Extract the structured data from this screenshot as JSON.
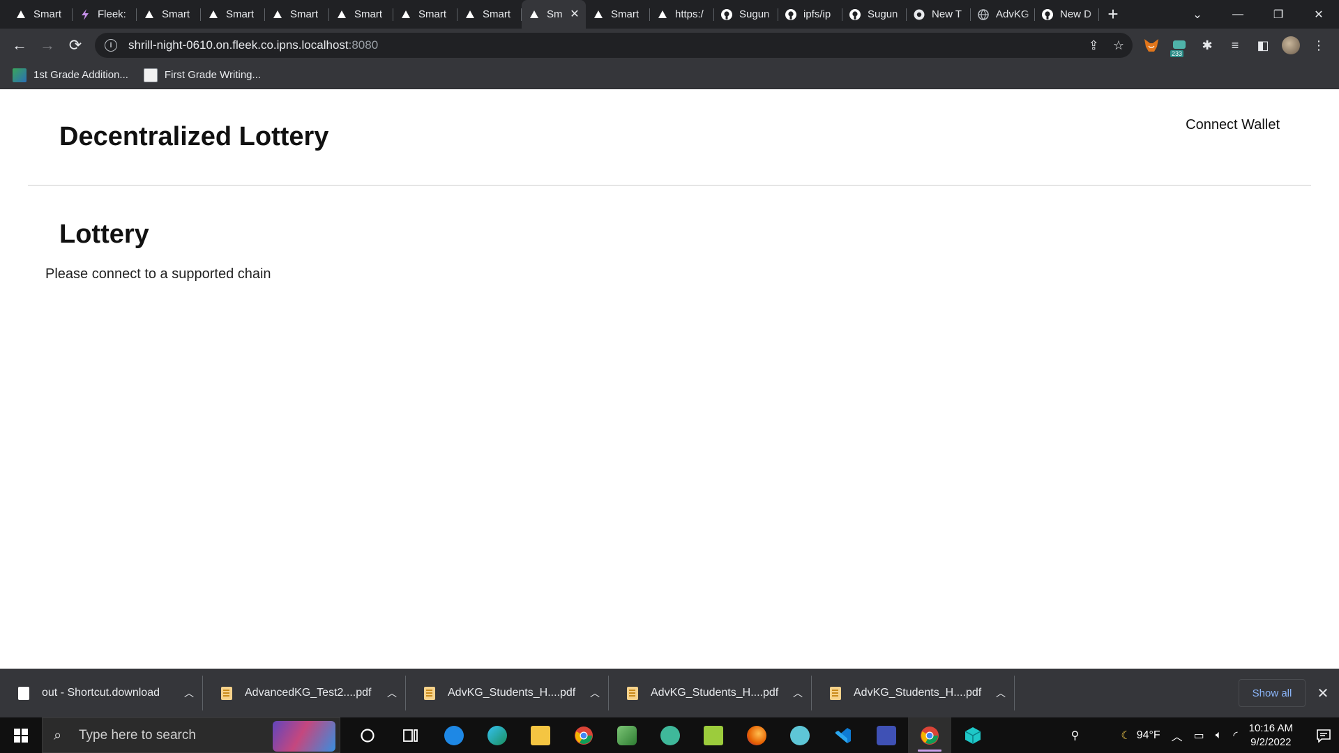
{
  "browser": {
    "tabs": [
      {
        "title": "Smart",
        "icon": "triangle-icon"
      },
      {
        "title": "Fleek:",
        "icon": "bolt-icon"
      },
      {
        "title": "Smart",
        "icon": "triangle-icon"
      },
      {
        "title": "Smart",
        "icon": "triangle-icon"
      },
      {
        "title": "Smart",
        "icon": "triangle-icon"
      },
      {
        "title": "Smart",
        "icon": "triangle-icon"
      },
      {
        "title": "Smart",
        "icon": "triangle-icon"
      },
      {
        "title": "Smart",
        "icon": "triangle-icon"
      },
      {
        "title": "Sm",
        "icon": "triangle-icon",
        "active": true
      },
      {
        "title": "Smart",
        "icon": "triangle-icon"
      },
      {
        "title": "https:/",
        "icon": "triangle-icon"
      },
      {
        "title": "Sugun",
        "icon": "github-icon"
      },
      {
        "title": "ipfs/ip",
        "icon": "github-icon"
      },
      {
        "title": "Sugun",
        "icon": "github-icon"
      },
      {
        "title": "New T",
        "icon": "chrome-icon"
      },
      {
        "title": "AdvKG",
        "icon": "globe-icon"
      },
      {
        "title": "New D",
        "icon": "github-icon"
      }
    ],
    "address": {
      "host": "shrill-night-0610.on.fleek.co.ipns.localhost",
      "port": ":8080"
    },
    "bookmarks": [
      {
        "label": "1st Grade Addition..."
      },
      {
        "label": "First Grade Writing..."
      }
    ],
    "extension_badge": "233"
  },
  "page": {
    "site_title": "Decentralized Lottery",
    "connect_label": "Connect Wallet",
    "section_title": "Lottery",
    "notice": "Please connect to a supported chain"
  },
  "downloads": {
    "items": [
      {
        "name": "out - Shortcut.download",
        "type": "file"
      },
      {
        "name": "AdvancedKG_Test2....pdf",
        "type": "pdf"
      },
      {
        "name": "AdvKG_Students_H....pdf",
        "type": "pdf"
      },
      {
        "name": "AdvKG_Students_H....pdf",
        "type": "pdf"
      },
      {
        "name": "AdvKG_Students_H....pdf",
        "type": "pdf"
      }
    ],
    "show_all_label": "Show all"
  },
  "taskbar": {
    "search_placeholder": "Type here to search",
    "weather": "94°F",
    "time": "10:16 AM",
    "date": "9/2/2022"
  },
  "colors": {
    "tabstrip": "#202124",
    "toolbar": "#35363a",
    "link_blue": "#8ab4f8",
    "page_bg": "#ffffff"
  }
}
